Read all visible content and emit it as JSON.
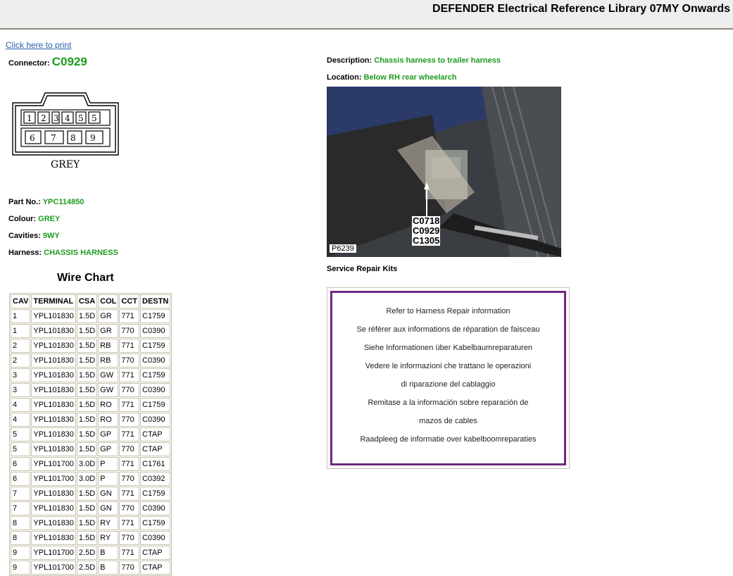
{
  "header": {
    "title": "DEFENDER Electrical Reference Library 07MY Onwards"
  },
  "print_link": "Click here to print",
  "connector": {
    "label": "Connector:",
    "value": "C0929",
    "drawing_colour_label": "GREY"
  },
  "properties": {
    "part_no": {
      "label": "Part No.:",
      "value": "YPC114850"
    },
    "colour": {
      "label": "Colour:",
      "value": "GREY"
    },
    "cavities": {
      "label": "Cavities:",
      "value": "9WY"
    },
    "harness": {
      "label": "Harness:",
      "value": "CHASSIS HARNESS"
    }
  },
  "description": {
    "label": "Description:",
    "value": "Chassis harness to trailer harness"
  },
  "location": {
    "label": "Location:",
    "value": "Below RH rear wheelarch"
  },
  "photo": {
    "callouts": [
      "C0718",
      "C0929",
      "C1305"
    ],
    "ref": "P6239"
  },
  "wire_chart": {
    "title": "Wire Chart",
    "headers": [
      "CAV",
      "TERMINAL",
      "CSA",
      "COL",
      "CCT",
      "DESTN"
    ],
    "rows": [
      [
        "1",
        "YPL101830",
        "1.5D",
        "GR",
        "771",
        "C1759"
      ],
      [
        "1",
        "YPL101830",
        "1.5D",
        "GR",
        "770",
        "C0390"
      ],
      [
        "2",
        "YPL101830",
        "1.5D",
        "RB",
        "771",
        "C1759"
      ],
      [
        "2",
        "YPL101830",
        "1.5D",
        "RB",
        "770",
        "C0390"
      ],
      [
        "3",
        "YPL101830",
        "1.5D",
        "GW",
        "771",
        "C1759"
      ],
      [
        "3",
        "YPL101830",
        "1.5D",
        "GW",
        "770",
        "C0390"
      ],
      [
        "4",
        "YPL101830",
        "1.5D",
        "RO",
        "771",
        "C1759"
      ],
      [
        "4",
        "YPL101830",
        "1.5D",
        "RO",
        "770",
        "C0390"
      ],
      [
        "5",
        "YPL101830",
        "1.5D",
        "GP",
        "771",
        "CTAP"
      ],
      [
        "5",
        "YPL101830",
        "1.5D",
        "GP",
        "770",
        "CTAP"
      ],
      [
        "6",
        "YPL101700",
        "3.0D",
        "P",
        "771",
        "C1761"
      ],
      [
        "6",
        "YPL101700",
        "3.0D",
        "P",
        "770",
        "C0392"
      ],
      [
        "7",
        "YPL101830",
        "1.5D",
        "GN",
        "771",
        "C1759"
      ],
      [
        "7",
        "YPL101830",
        "1.5D",
        "GN",
        "770",
        "C0390"
      ],
      [
        "8",
        "YPL101830",
        "1.5D",
        "RY",
        "771",
        "C1759"
      ],
      [
        "8",
        "YPL101830",
        "1.5D",
        "RY",
        "770",
        "C0390"
      ],
      [
        "9",
        "YPL101700",
        "2.5D",
        "B",
        "771",
        "CTAP"
      ],
      [
        "9",
        "YPL101700",
        "2.5D",
        "B",
        "770",
        "CTAP"
      ]
    ]
  },
  "service_repair": {
    "title": "Service Repair Kits",
    "lines": [
      "Refer to Harness Repair information",
      "Se référer aux informations de réparation de faisceau",
      "Siehe Informationen über Kabelbaumreparaturen",
      "Vedere le informazioni che trattano le operazioni",
      "di riparazione del cablaggio",
      "Remitase a la información sobre reparación de",
      "mazos de cables",
      "Raadpleeg de informatie over kabelboomreparaties"
    ]
  },
  "colors": {
    "green_value": "#1e9a1e",
    "link": "#2a5db0",
    "repair_border": "#6e2a82",
    "header_bg": "#eeeeee"
  }
}
